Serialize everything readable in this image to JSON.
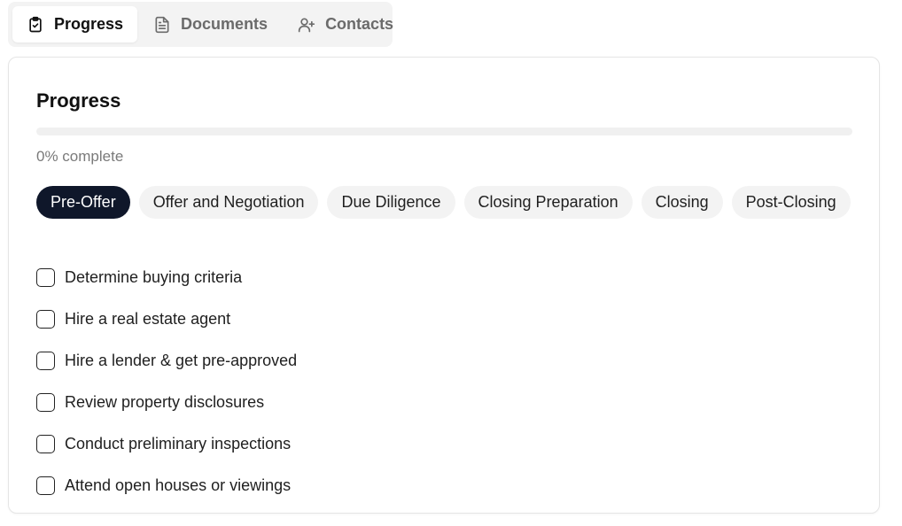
{
  "tabs": [
    {
      "label": "Progress",
      "icon": "clipboard-check-icon",
      "active": true
    },
    {
      "label": "Documents",
      "icon": "document-icon",
      "active": false
    },
    {
      "label": "Contacts",
      "icon": "user-plus-icon",
      "active": false
    }
  ],
  "card": {
    "title": "Progress",
    "progress_percent": 0,
    "progress_text": "0% complete"
  },
  "stages": [
    {
      "label": "Pre-Offer",
      "active": true
    },
    {
      "label": "Offer and Negotiation",
      "active": false
    },
    {
      "label": "Due Diligence",
      "active": false
    },
    {
      "label": "Closing Preparation",
      "active": false
    },
    {
      "label": "Closing",
      "active": false
    },
    {
      "label": "Post-Closing",
      "active": false
    }
  ],
  "tasks": [
    {
      "label": "Determine buying criteria",
      "checked": false
    },
    {
      "label": "Hire a real estate agent",
      "checked": false
    },
    {
      "label": "Hire a lender & get pre-approved",
      "checked": false
    },
    {
      "label": "Review property disclosures",
      "checked": false
    },
    {
      "label": "Conduct preliminary inspections",
      "checked": false
    },
    {
      "label": "Attend open houses or viewings",
      "checked": false
    }
  ],
  "colors": {
    "accent": "#0f172a",
    "chip_bg": "#f3f3f3",
    "muted_text": "#7a7a7a"
  }
}
